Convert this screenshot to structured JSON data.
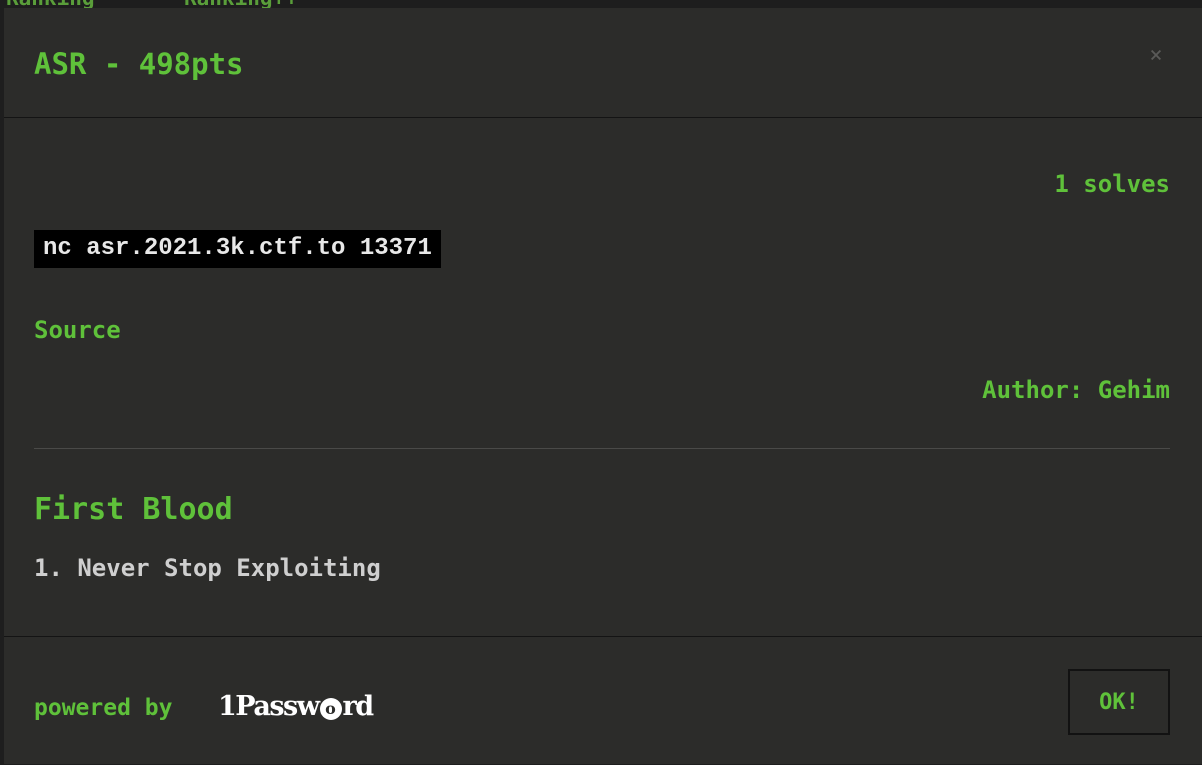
{
  "background_nav": {
    "items": [
      "Ranking",
      "Ranking++"
    ]
  },
  "modal": {
    "title": "ASR - 498pts",
    "close_label": "×",
    "solves": "1 solves",
    "connection_command": "nc asr.2021.3k.ctf.to 13371",
    "source_link": "Source",
    "author": "Author: Gehim",
    "first_blood": {
      "heading": "First Blood",
      "entries": [
        "1. Never Stop Exploiting"
      ]
    },
    "footer": {
      "powered_by": "powered by",
      "logo_text": "1Passw",
      "logo_mark": "o",
      "logo_tail": "rd",
      "ok_label": "OK!"
    }
  },
  "colors": {
    "accent": "#5fc13a",
    "modal_bg": "#2c2c2a",
    "code_bg": "#000000"
  }
}
